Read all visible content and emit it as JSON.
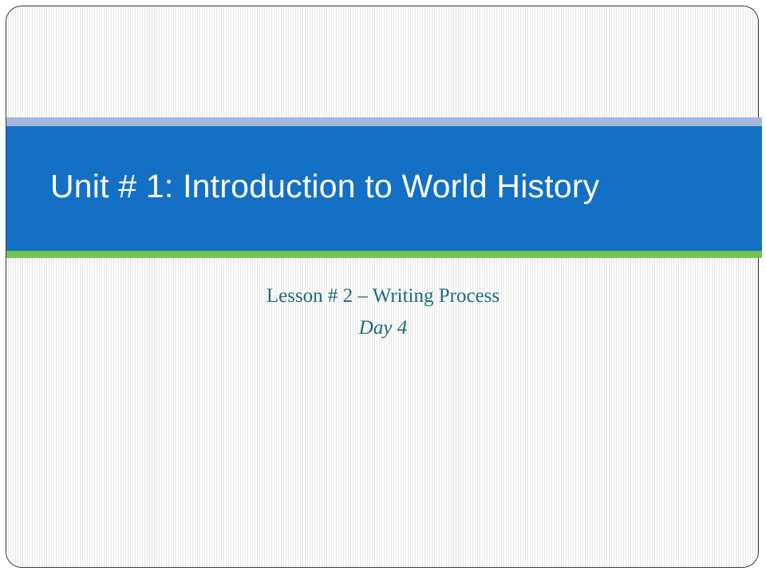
{
  "slide": {
    "title": "Unit # 1: Introduction to World History",
    "subtitle_line1": "Lesson # 2 – Writing Process",
    "subtitle_line2": "Day 4"
  },
  "colors": {
    "title_band": "#1470c5",
    "top_stripe": "#a4b7dc",
    "bottom_stripe": "#72c44d",
    "subtitle_text": "#1d6c7a",
    "title_text": "#ffffff"
  }
}
